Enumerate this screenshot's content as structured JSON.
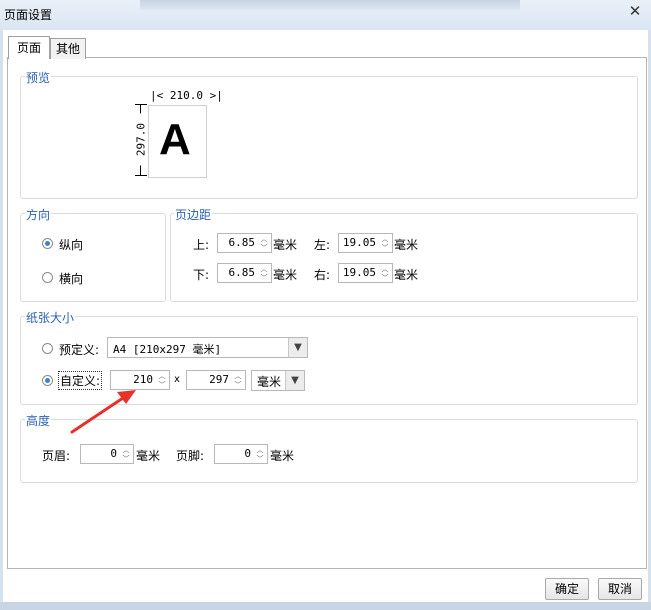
{
  "window": {
    "title": "页面设置",
    "close": "✕"
  },
  "tabs": [
    {
      "label": "页面"
    },
    {
      "label": "其他"
    }
  ],
  "preview": {
    "label": "预览",
    "width": "210.0",
    "height": "297.0",
    "sample": "A"
  },
  "orientation": {
    "label": "方向",
    "portrait": "纵向",
    "landscape": "横向",
    "selected": "portrait"
  },
  "margins": {
    "label": "页边距",
    "top_label": "上:",
    "top": "6.85",
    "bottom_label": "下:",
    "bottom": "6.85",
    "left_label": "左:",
    "left": "19.05",
    "right_label": "右:",
    "right": "19.05",
    "unit": "毫米"
  },
  "paper": {
    "label": "纸张大小",
    "predefined_label": "预定义:",
    "predefined_value": "A4 [210x297 毫米]",
    "custom_label": "自定义:",
    "custom_width": "210",
    "times": "x",
    "custom_height": "297",
    "unit": "毫米",
    "selected": "custom"
  },
  "height_group": {
    "label": "高度",
    "header_label": "页眉:",
    "header": "0",
    "footer_label": "页脚:",
    "footer": "0",
    "unit": "毫米"
  },
  "buttons": {
    "ok": "确定",
    "cancel": "取消"
  },
  "colors": {
    "group_label": "#2a62b0",
    "annotation_arrow": "#e8312a",
    "radio_selected": "#3d7fd4"
  }
}
